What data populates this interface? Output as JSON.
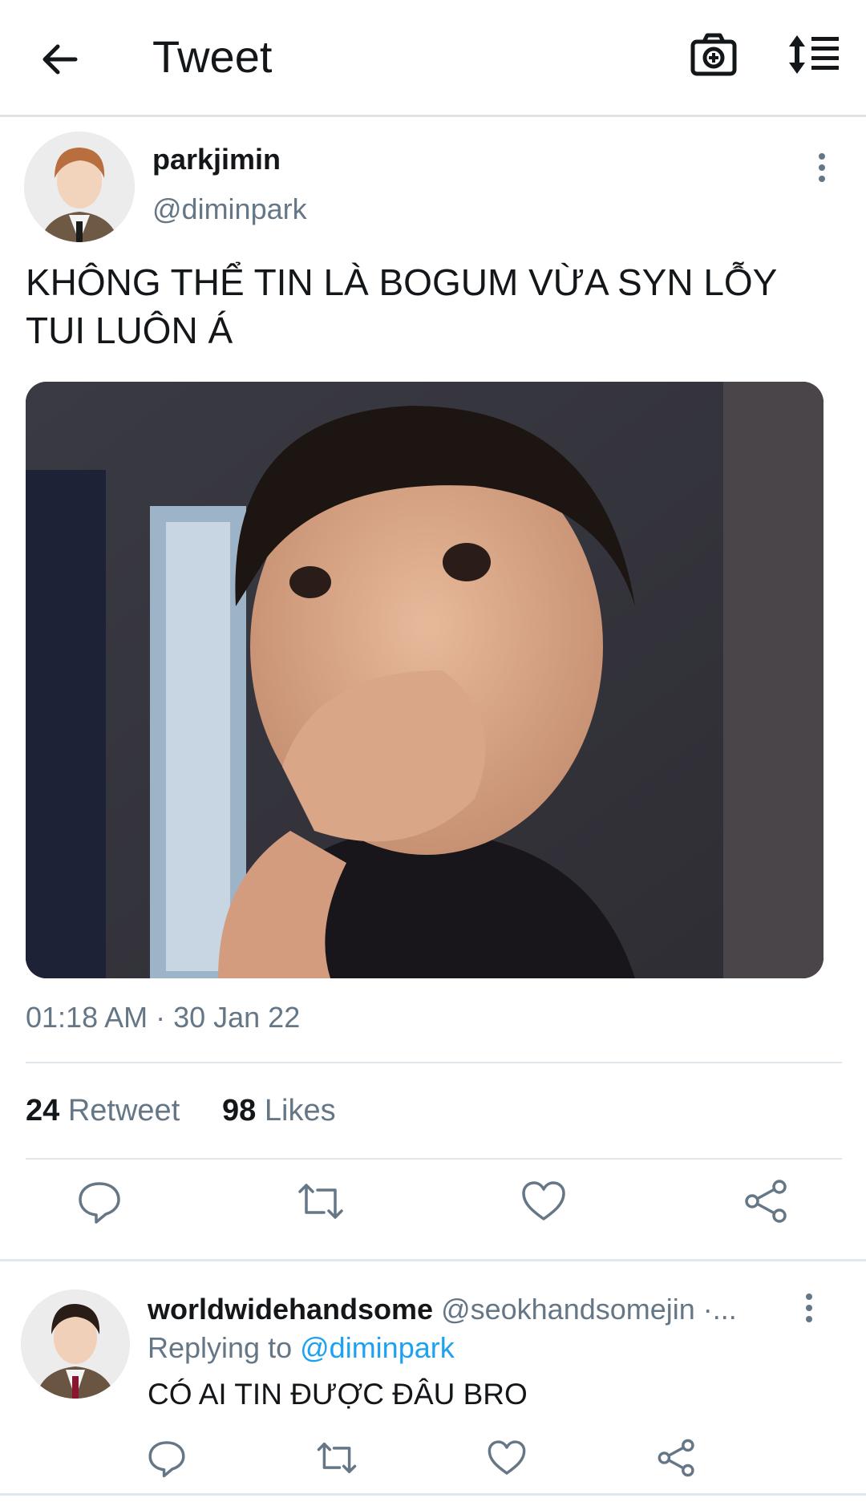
{
  "header": {
    "title": "Tweet",
    "back_icon": "arrow-left-icon",
    "camera_icon": "camera-plus-icon",
    "sort_icon": "sort-list-icon"
  },
  "tweet": {
    "name": "parkjimin",
    "handle": "@diminpark",
    "text": "KHÔNG THỂ TIN LÀ BOGUM VỪA SYN LỖY TUI LUÔN Á",
    "timestamp": "01:18 AM · 30 Jan 22",
    "retweet_count": "24",
    "retweet_label": "Retweet",
    "likes_count": "98",
    "likes_label": "Likes"
  },
  "reply": {
    "name": "worldwidehandsome",
    "handle": "@seokhandsomejin ·...",
    "replying_prefix": "Replying to",
    "replying_mention": "@diminpark",
    "text": "CÓ AI TIN ĐƯỢC ĐÂU BRO"
  },
  "colors": {
    "text_primary": "#14171a",
    "text_secondary": "#657786",
    "accent": "#1da1f2",
    "divider": "#e1e8ed"
  }
}
